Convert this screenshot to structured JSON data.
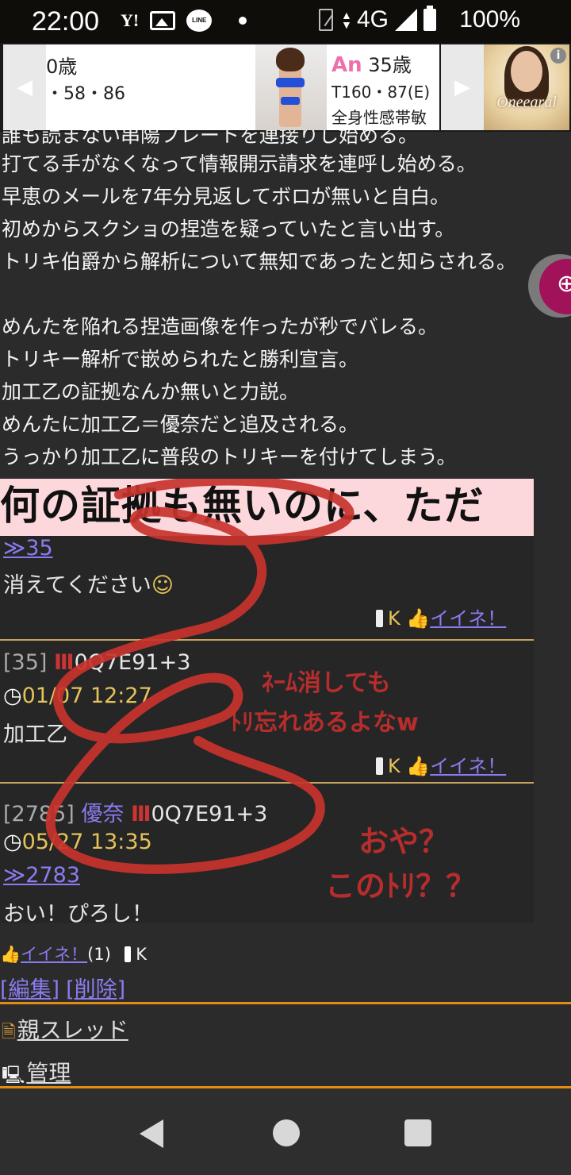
{
  "status_bar": {
    "time": "22:00",
    "yahoo_icon": "Y!",
    "line_icon": "LINE",
    "network": "4G",
    "battery": "100%"
  },
  "ad": {
    "card1_line1": "0歳",
    "card1_line2": "・58・86",
    "card2_name": "An",
    "card2_age": "35歳",
    "card2_stats": "T160・87(E)",
    "card2_desc": "全身性感帯敏",
    "logo_text": "Oneearal",
    "info_icon": "i"
  },
  "lines": [
    "誰も読まない串陽フレートを連接りし始める。",
    "打てる手がなくなって情報開示請求を連呼し始める。",
    "早恵のメールを7年分見返してボロが無いと自白。",
    "初めからスクショの捏造を疑っていたと言い出す。",
    "トリキ伯爵から解析について無知であったと知らされる。",
    "めんたを陥れる捏造画像を作ったが秒でバレる。",
    "トリキー解析で嵌められたと勝利宣言。",
    "加工乙の証拠なんか無いと力説。",
    "めんたに加工乙＝優奈だと追及される。",
    "うっかり加工乙に普段のトリキーを付けてしまう。"
  ],
  "screenshot": {
    "banner_text": "何の証拠も無いのに、ただ",
    "post1_anchor": "≫35",
    "post1_body": "消えてください",
    "post1_k": "K",
    "post1_like": "イイネ！",
    "post2_num": "[35]",
    "post2_trip": "0Q7E91+3",
    "post2_date": "01/07 12:27",
    "post2_body": "加工乙",
    "post2_k": "K",
    "post2_like": "イイネ！",
    "post3_num": "[2785]",
    "post3_name": "優奈",
    "post3_trip": "0Q7E91+3",
    "post3_date": "05/27 13:35",
    "post3_anchor": "≫2783",
    "post3_body": "おい！ぴろし！",
    "annotation1_line1": "ﾈｰﾑ消しても",
    "annotation1_line2": "ﾄﾘ忘れあるよなw",
    "annotation2_line1": "おや？",
    "annotation2_line2": "このﾄﾘ？？"
  },
  "footer": {
    "like_label": "イイネ！",
    "like_count": "(1)",
    "k_label": "K",
    "edit_label": "[編集]",
    "delete_label": "[削除]",
    "parent_thread": "親スレッド",
    "admin": "管理"
  },
  "colors": {
    "accent_orange": "#e58a13",
    "link": "#8a7cf0",
    "annotation_red": "#b62d2d"
  }
}
